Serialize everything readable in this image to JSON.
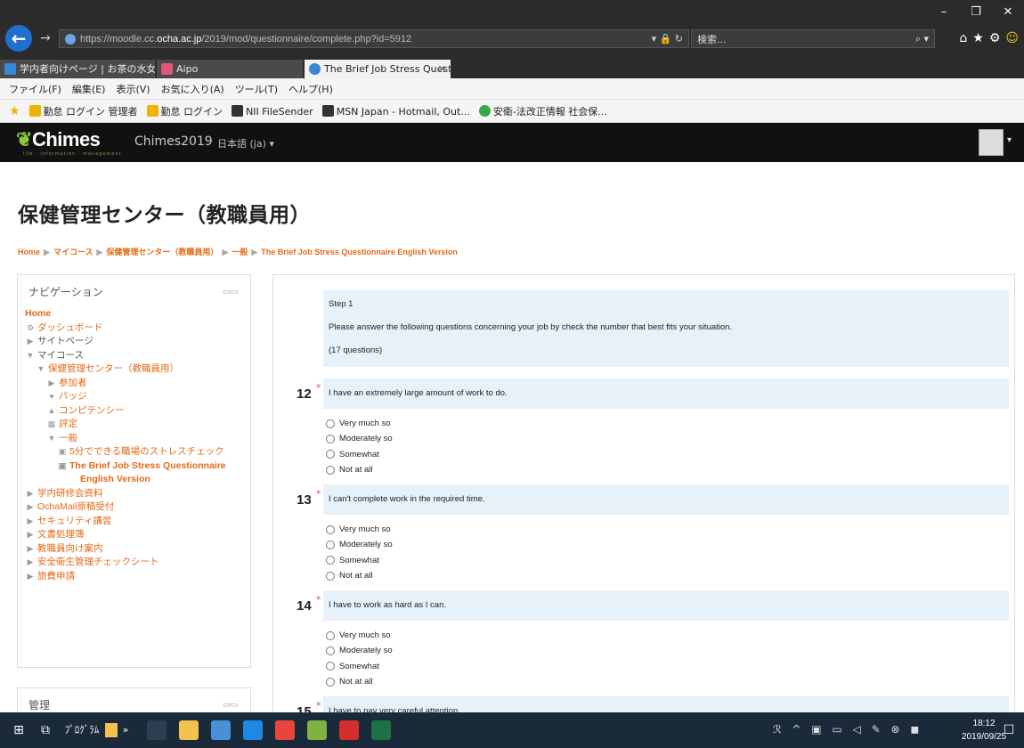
{
  "browser": {
    "url_prefix": "https://moodle.cc.",
    "url_domain": "ocha.ac.jp",
    "url_path": "/2019/mod/questionnaire/complete.php?id=5912",
    "addr_icons": "▾ 🔒 ↻",
    "search_placeholder": "検索...",
    "search_icon": "⌕ ▾",
    "toolbar_icons": [
      "⌂",
      "★",
      "⚙",
      "☺"
    ],
    "window_controls": [
      "–",
      "❐",
      "✕"
    ],
    "tabs": [
      {
        "label": "学内者向けページ | お茶の水女子...",
        "icon_color": "#3a86d8"
      },
      {
        "label": "Aipo",
        "icon_color": "#e0577a"
      },
      {
        "label": "The Brief Job Stress Questio...",
        "icon_color": "#3a86d8",
        "close": "✕"
      }
    ],
    "menu": [
      "ファイル(F)",
      "編集(E)",
      "表示(V)",
      "お気に入り(A)",
      "ツール(T)",
      "ヘルプ(H)"
    ],
    "favorites": [
      {
        "label": "勤怠 ログイン 管理者",
        "icon_color": "#f0b400"
      },
      {
        "label": "勤怠 ログイン",
        "icon_color": "#f0b400"
      },
      {
        "label": "NII FileSender",
        "icon_color": "#333"
      },
      {
        "label": "MSN Japan - Hotmail, Out...",
        "icon_color": "#333"
      },
      {
        "label": "安衛-法改正情報 社会保...",
        "icon_color": "#3aa84a"
      }
    ]
  },
  "moodle": {
    "logo": "Chimes",
    "logo_tagline": "life · information · management",
    "site_name": "Chimes2019",
    "language": "日本語 (ja) ▾",
    "user_caret": "▾"
  },
  "page": {
    "title": "保健管理センター（教職員用）",
    "breadcrumb": [
      "Home",
      "マイコース",
      "保健管理センター（教職員用）",
      "一般",
      "The Brief Job Stress Questionnaire English Version"
    ],
    "breadcrumb_sep": "▶"
  },
  "navigation": {
    "title": "ナビゲーション",
    "controls": "▭▭",
    "items": [
      {
        "label": "Home",
        "indent": 0,
        "icon": "",
        "style": "org bold"
      },
      {
        "label": "ダッシュボード",
        "indent": 0,
        "icon": "⚙",
        "style": "org"
      },
      {
        "label": "サイトページ",
        "indent": 0,
        "icon": "▶",
        "style": "gray"
      },
      {
        "label": "マイコース",
        "indent": 0,
        "icon": "▼",
        "style": "gray"
      },
      {
        "label": "保健管理センター（教職員用）",
        "indent": 1,
        "icon": "▼",
        "style": "org"
      },
      {
        "label": "参加者",
        "indent": 2,
        "icon": "▶",
        "style": "org"
      },
      {
        "label": "バッジ",
        "indent": 2,
        "icon": "♥",
        "style": "org"
      },
      {
        "label": "コンピテンシー",
        "indent": 2,
        "icon": "▲",
        "style": "org"
      },
      {
        "label": "評定",
        "indent": 2,
        "icon": "▦",
        "style": "org"
      },
      {
        "label": "一般",
        "indent": 2,
        "icon": "▼",
        "style": "org"
      },
      {
        "label": "5分でできる職場のストレスチェック",
        "indent": 3,
        "icon": "▣",
        "style": "org"
      },
      {
        "label": "The Brief Job Stress Questionnaire",
        "indent": 3,
        "icon": "▣",
        "style": "org bold"
      },
      {
        "label": "English Version",
        "indent": 4,
        "icon": "",
        "style": "org bold"
      },
      {
        "label": "学内研修会資料",
        "indent": 0,
        "icon": "▶",
        "style": "org"
      },
      {
        "label": "OchaMail原稿受付",
        "indent": 0,
        "icon": "▶",
        "style": "org"
      },
      {
        "label": "セキュリティ講習",
        "indent": 0,
        "icon": "▶",
        "style": "org"
      },
      {
        "label": "文書処理簿",
        "indent": 0,
        "icon": "▶",
        "style": "org"
      },
      {
        "label": "教職員向け案内",
        "indent": 0,
        "icon": "▶",
        "style": "org"
      },
      {
        "label": "安全衛生管理チェックシート",
        "indent": 0,
        "icon": "▶",
        "style": "org"
      },
      {
        "label": "旅費申請",
        "indent": 0,
        "icon": "▶",
        "style": "org"
      }
    ]
  },
  "admin_block": {
    "title": "管理",
    "controls": "▭▭"
  },
  "questionnaire": {
    "step_title": "Step 1",
    "instructions": "Please answer the following questions concerning your job by check the number that best fits your situation.",
    "count": "(17 questions)",
    "required_mark": "*",
    "questions": [
      {
        "number": "12",
        "text": "I have an extremely large amount of work to do.",
        "options": [
          "Very much so",
          "Moderately so",
          "Somewhat",
          "Not at all"
        ]
      },
      {
        "number": "13",
        "text": "I can't complete work in the required time.",
        "options": [
          "Very much so",
          "Moderately so",
          "Somewhat",
          "Not at all"
        ]
      },
      {
        "number": "14",
        "text": "I have to work as hard as I can.",
        "options": [
          "Very much so",
          "Moderately so",
          "Somewhat",
          "Not at all"
        ]
      },
      {
        "number": "15",
        "text": "I have to pay very careful attention.",
        "options": []
      }
    ]
  },
  "taskbar": {
    "start_icon": "⊞",
    "view_icon": "⧉",
    "programs_label": "ﾌﾟﾛｸﾞﾗﾑ",
    "chevron": "»",
    "apps": [
      {
        "name": "cmd-app",
        "color": "#2c3e50"
      },
      {
        "name": "explorer-app",
        "color": "#f2c14e"
      },
      {
        "name": "security-app",
        "color": "#4a90d9"
      },
      {
        "name": "ie-app",
        "color": "#1e88e5"
      },
      {
        "name": "chrome-app",
        "color": "#e8453c"
      },
      {
        "name": "network-app",
        "color": "#7cb342"
      },
      {
        "name": "acrobat-app",
        "color": "#d32f2f"
      },
      {
        "name": "excel-app",
        "color": "#1e7145"
      }
    ],
    "tray": "ℛ ^ ▣ ▭ ◁ ✎ ⊗ ◼",
    "time": "18:12",
    "date": "2019/09/25",
    "notification_icon": "☐"
  }
}
